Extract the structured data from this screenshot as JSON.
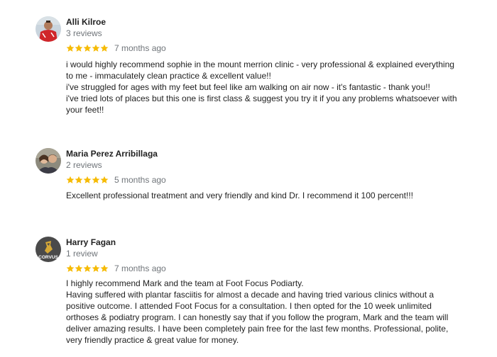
{
  "colors": {
    "star": "#F6BB06",
    "muted_text": "#70757a",
    "text": "#222222"
  },
  "reviews": [
    {
      "avatar": "avatar-photo-red-shirt",
      "name": "Alli Kilroe",
      "count": "3 reviews",
      "rating": 5,
      "date": "7 months ago",
      "lines": [
        "i would highly recommend sophie in the mount merrion clinic - very professional & explained everything to me - immaculately clean practice & excellent value!!",
        "i've struggled for ages with my feet but feel like am walking on air now - it's fantastic - thank you!!",
        "i've tried lots of places but this one is first class & suggest you try it if you any problems whatsoever with your feet!!"
      ]
    },
    {
      "avatar": "avatar-photo-couple",
      "name": "Maria Perez Arribillaga",
      "count": "2 reviews",
      "rating": 5,
      "date": "5 months ago",
      "lines": [
        "Excellent professional treatment and very friendly and kind Dr. I recommend it 100 percent!!!"
      ]
    },
    {
      "avatar": "avatar-logo-corvus",
      "avatar_logo_text": "CORVUS",
      "name": "Harry Fagan",
      "count": "1 review",
      "rating": 5,
      "date": "7 months ago",
      "lines": [
        "I highly recommend Mark and the team at Foot Focus Podiarty.",
        "Having suffered with plantar fasciitis for almost a decade and having tried various clinics without a positive outcome. I attended Foot Focus for a consultation. I then opted for the 10 week unlimited orthoses & podiatry program. I can honestly say that if you follow the program, Mark and the team will deliver amazing results. I have been completely pain free for the last few months. Professional, polite, very friendly practice & great value for money."
      ]
    }
  ]
}
